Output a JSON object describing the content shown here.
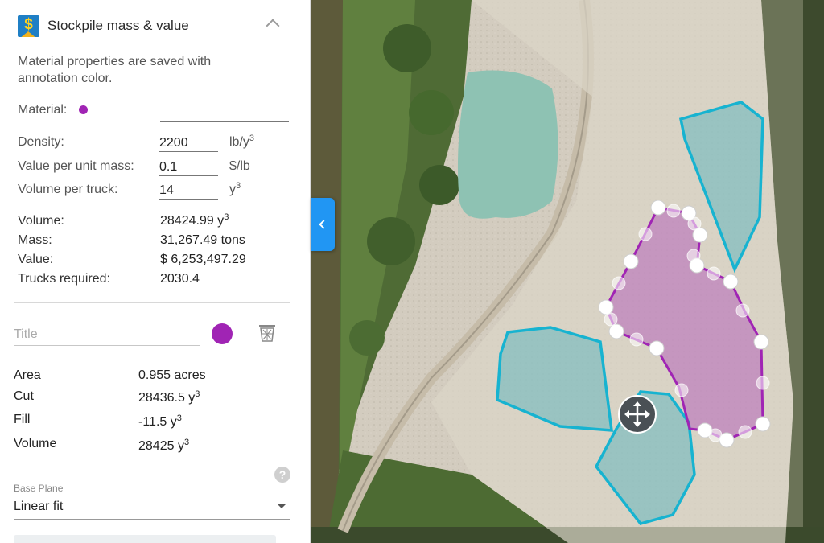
{
  "panel": {
    "title": "Stockpile mass & value",
    "description": "Material properties are saved with annotation color.",
    "material": {
      "label": "Material:",
      "value": "",
      "color": "#a024b4"
    },
    "inputs": {
      "density": {
        "label": "Density:",
        "value": "2200",
        "unit": "lb/y",
        "unit_sup": "3"
      },
      "value_per_mass": {
        "label": "Value per unit mass:",
        "value": "0.1",
        "unit": "$/lb"
      },
      "volume_per_truck": {
        "label": "Volume per truck:",
        "value": "14",
        "unit": "y",
        "unit_sup": "3"
      }
    },
    "results": {
      "volume": {
        "label": "Volume:",
        "value": "28424.99 y",
        "sup": "3"
      },
      "mass": {
        "label": "Mass:",
        "value": "31,267.49 tons"
      },
      "value": {
        "label": "Value:",
        "value": "$ 6,253,497.29"
      },
      "trucks": {
        "label": "Trucks required:",
        "value": "2030.4"
      }
    },
    "annotation": {
      "title_placeholder": "Title",
      "color": "#a024b4",
      "stats": {
        "area": {
          "label": "Area",
          "value": "0.955 acres"
        },
        "cut": {
          "label": "Cut",
          "value": "28436.5 y",
          "sup": "3"
        },
        "fill": {
          "label": "Fill",
          "value": "-11.5 y",
          "sup": "3"
        },
        "volume": {
          "label": "Volume",
          "value": "28425 y",
          "sup": "3"
        }
      },
      "help_glyph": "?",
      "base_plane": {
        "caption": "Base Plane",
        "value": "Linear fit"
      }
    }
  },
  "icons": {
    "app": "stockpile-dollar-icon",
    "collapse": "chevron-up-icon",
    "trash": "trash-icon",
    "help": "help-icon",
    "panel_toggle": "chevron-left-icon",
    "move": "move-arrows-icon"
  },
  "colors": {
    "accent_blue": "#2196f3",
    "polygon_cyan": "#17b3d0",
    "polygon_purple": "#a024b4"
  }
}
